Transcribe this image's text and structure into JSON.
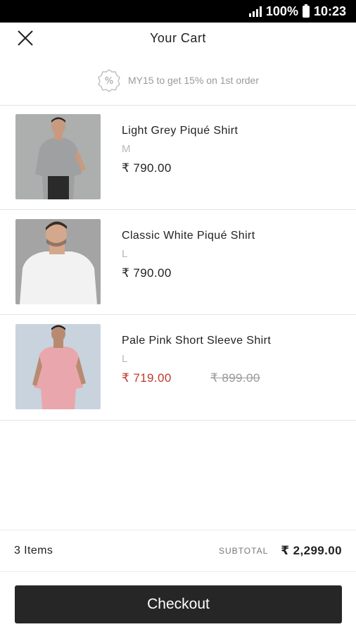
{
  "status_bar": {
    "battery": "100%",
    "time": "10:23"
  },
  "header": {
    "title": "Your Cart",
    "close_icon": "close-icon"
  },
  "promo": {
    "icon": "percent-badge-icon",
    "text": "MY15 to get 15% on 1st order"
  },
  "cart": {
    "items": [
      {
        "name": "Light Grey Piqué Shirt",
        "size": "M",
        "price": "₹ 790.00",
        "colors": {
          "shirt": "#9fa0a2",
          "bg": "#a9aaab"
        }
      },
      {
        "name": "Classic White Piqué Shirt",
        "size": "L",
        "price": "₹ 790.00",
        "colors": {
          "shirt": "#f2f2f2",
          "bg": "#a4a4a4"
        }
      },
      {
        "name": "Pale Pink Short Sleeve Shirt",
        "size": "L",
        "price": "₹ 719.00",
        "mrp": "₹ 899.00",
        "colors": {
          "shirt": "#e9a7ad",
          "bg": "#c8d3de"
        }
      }
    ]
  },
  "summary": {
    "count": "3  Items",
    "subtotal_label": "SUBTOTAL",
    "subtotal_value": "₹ 2,299.00"
  },
  "checkout_label": "Checkout",
  "colors": {
    "sale_price": "#c0392b",
    "button_bg": "#262626"
  }
}
